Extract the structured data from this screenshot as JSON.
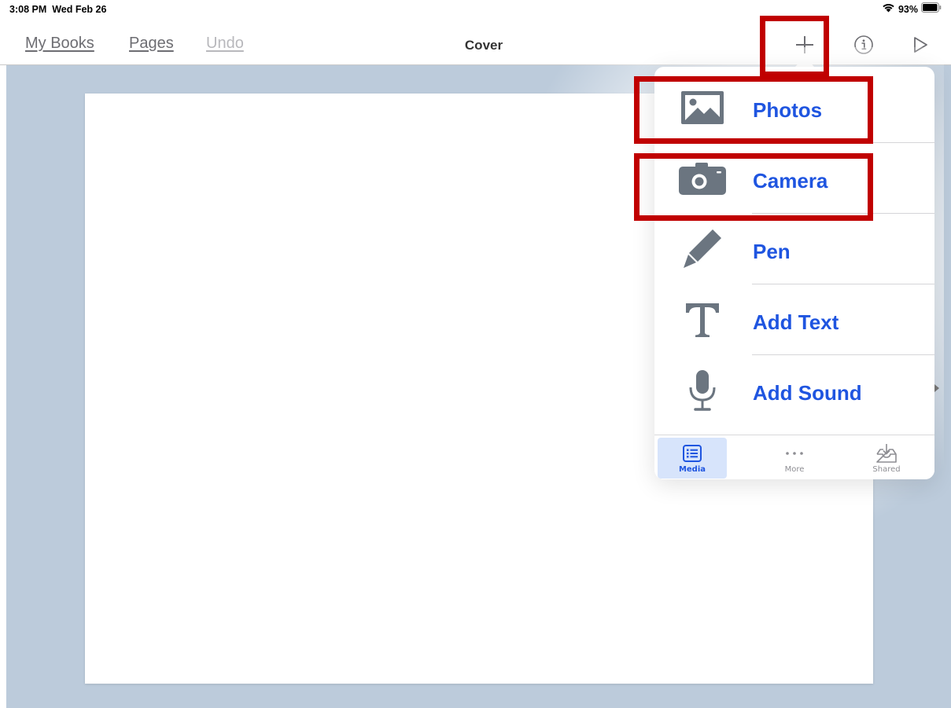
{
  "status_bar": {
    "time": "3:08 PM",
    "date": "Wed Feb 26",
    "battery": "93%",
    "icons": [
      "wifi-icon",
      "battery-icon"
    ]
  },
  "toolbar": {
    "my_books": "My Books",
    "pages": "Pages",
    "undo": "Undo",
    "title": "Cover",
    "icons": [
      "plus-icon",
      "info-icon",
      "play-icon"
    ]
  },
  "popover": {
    "items": [
      {
        "label": "Photos",
        "icon": "photo-icon"
      },
      {
        "label": "Camera",
        "icon": "camera-icon"
      },
      {
        "label": "Pen",
        "icon": "pen-icon"
      },
      {
        "label": "Add Text",
        "icon": "text-icon"
      },
      {
        "label": "Add Sound",
        "icon": "microphone-icon"
      }
    ],
    "tabs": [
      {
        "label": "Media",
        "icon": "media-icon",
        "selected": true
      },
      {
        "label": "More",
        "icon": "more-icon",
        "selected": false
      },
      {
        "label": "Shared",
        "icon": "shared-icon",
        "selected": false
      }
    ]
  },
  "colors": {
    "accent": "#1f55e0",
    "canvas_bg": "#bccbdb",
    "icon_gray": "#6b7580",
    "highlight": "#c00000"
  }
}
